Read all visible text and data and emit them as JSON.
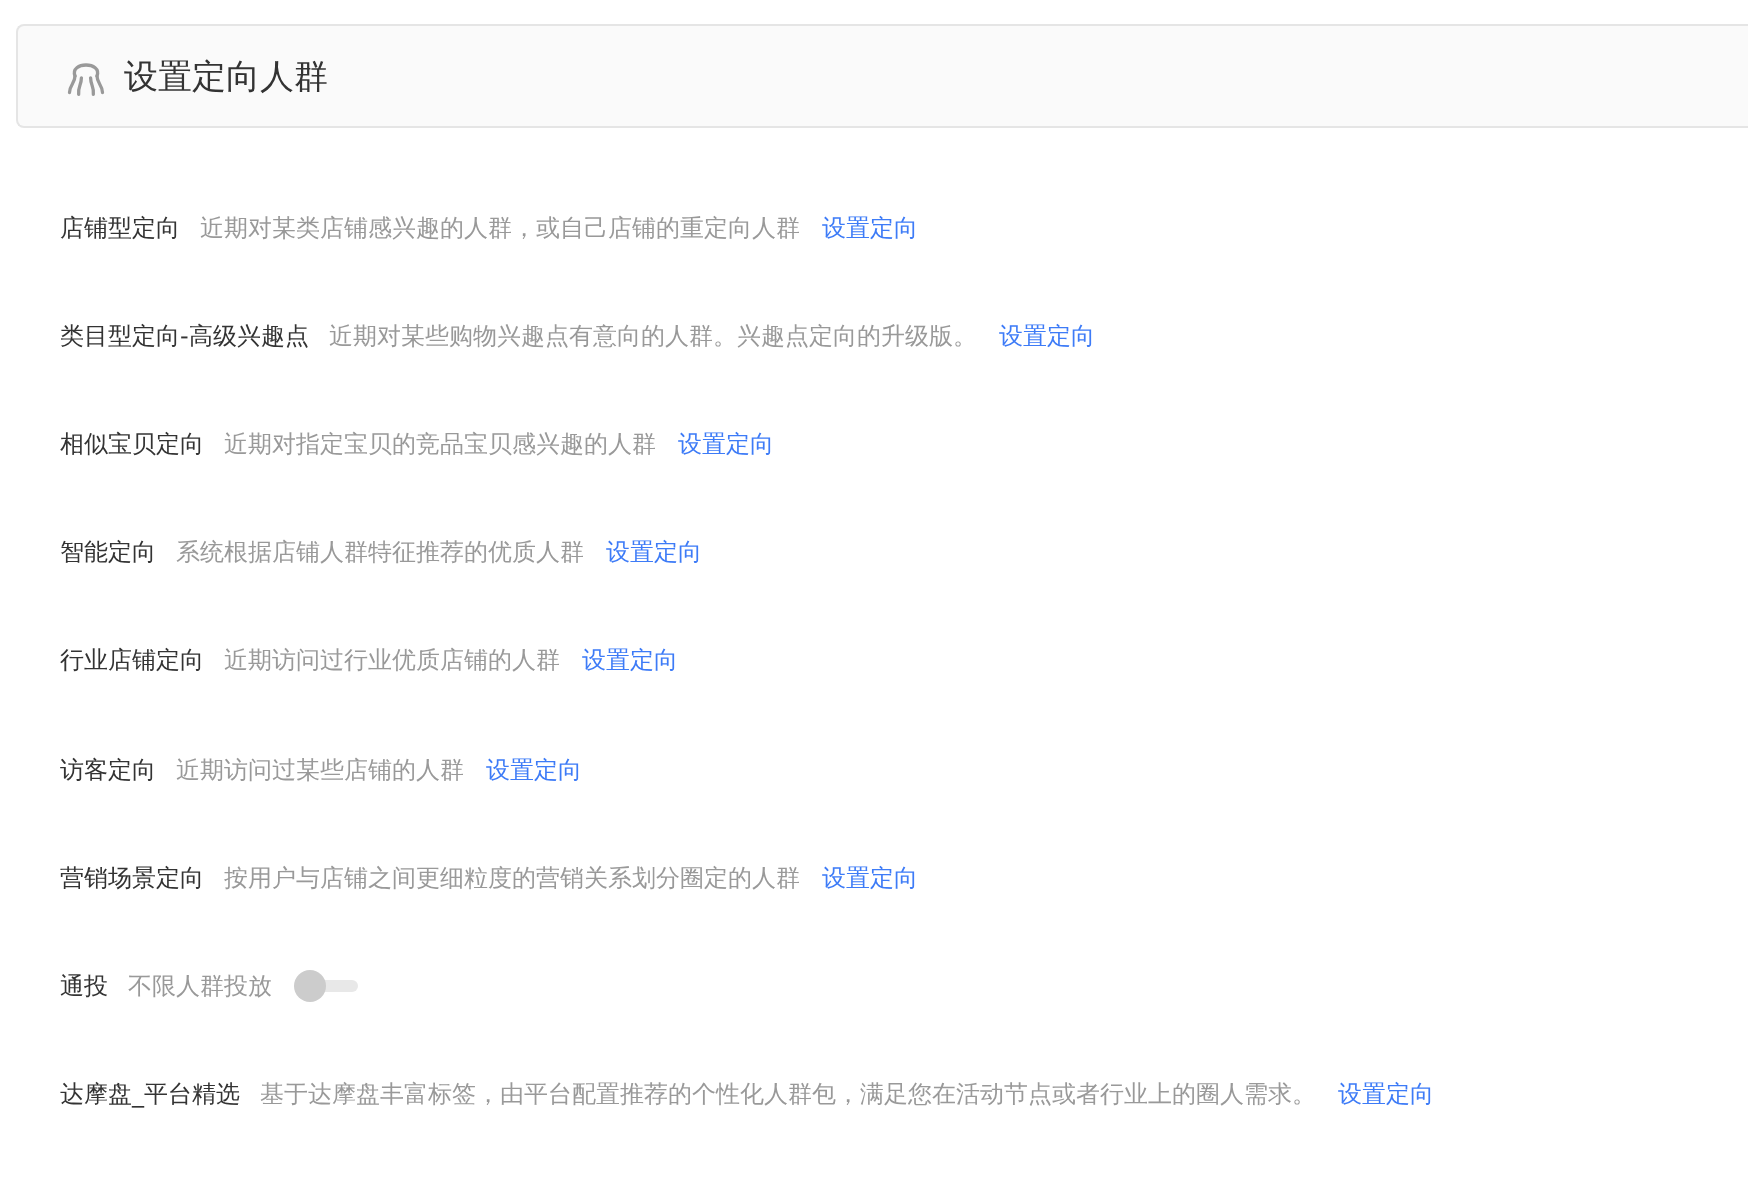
{
  "header": {
    "title": "设置定向人群"
  },
  "rows": [
    {
      "kind": "link",
      "label": "店铺型定向",
      "description": "近期对某类店铺感兴趣的人群，或自己店铺的重定向人群",
      "link": "设置定向"
    },
    {
      "kind": "link",
      "label": "类目型定向-高级兴趣点",
      "description": "近期对某些购物兴趣点有意向的人群。兴趣点定向的升级版。",
      "link": "设置定向"
    },
    {
      "kind": "link",
      "label": "相似宝贝定向",
      "description": "近期对指定宝贝的竞品宝贝感兴趣的人群",
      "link": "设置定向"
    },
    {
      "kind": "link",
      "label": "智能定向",
      "description": "系统根据店铺人群特征推荐的优质人群",
      "link": "设置定向"
    },
    {
      "kind": "link",
      "label": "行业店铺定向",
      "description": "近期访问过行业优质店铺的人群",
      "link": "设置定向"
    },
    {
      "kind": "link",
      "label": "访客定向",
      "description": "近期访问过某些店铺的人群",
      "link": "设置定向"
    },
    {
      "kind": "link",
      "label": "营销场景定向",
      "description": "按用户与店铺之间更细粒度的营销关系划分圈定的人群",
      "link": "设置定向"
    },
    {
      "kind": "toggle",
      "label": "通投",
      "description": "不限人群投放",
      "on": false
    },
    {
      "kind": "link",
      "label": "达摩盘_平台精选",
      "description": "基于达摩盘丰富标签，由平台配置推荐的个性化人群包，满足您在活动节点或者行业上的圈人需求。",
      "link": "设置定向"
    }
  ]
}
